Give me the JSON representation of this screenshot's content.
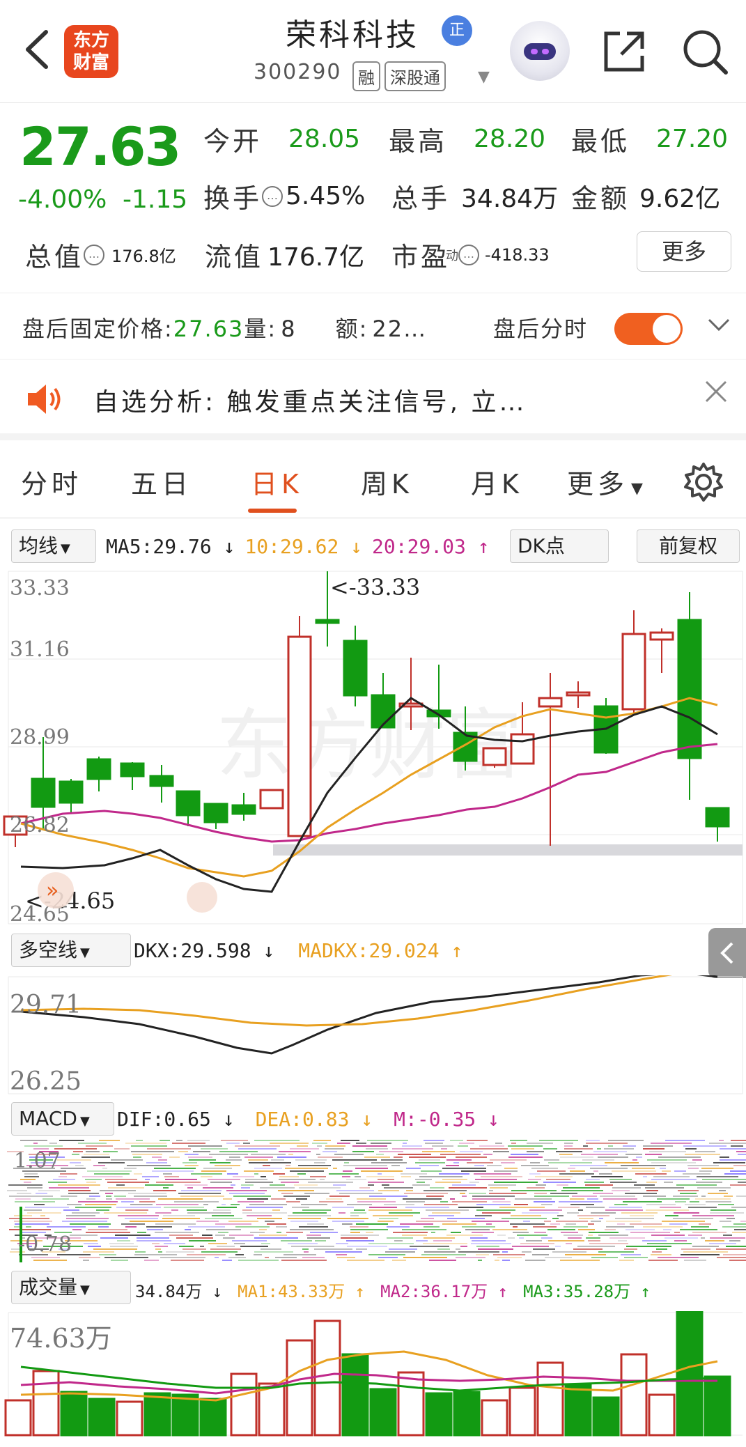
{
  "header": {
    "back_icon": "back-arrow-icon",
    "logo_line1": "东方",
    "logo_line2": "财富",
    "stock_name": "荣科科技",
    "badge": "正",
    "stock_code": "300290",
    "tags": [
      "融",
      "深股通"
    ]
  },
  "quote": {
    "price": "27.63",
    "change_pct": "-4.00%",
    "change_val": "-1.15",
    "open_label": "今开",
    "open": "28.05",
    "high_label": "最高",
    "high": "28.20",
    "low_label": "最低",
    "low": "27.20",
    "turnover_label": "换手",
    "turnover": "5.45%",
    "volume_label": "总手",
    "volume": "34.84万",
    "amount_label": "金额",
    "amount": "9.62亿",
    "mktcap_label": "总值",
    "mktcap": "176.8亿",
    "float_label": "流值",
    "float": "176.7亿",
    "pe_label": "市盈",
    "pe_sup": "动",
    "pe": "-418.33",
    "more_button": "更多"
  },
  "afterhours": {
    "price_label": "盘后固定价格:",
    "price": "27.63",
    "vol_label": "量:",
    "vol": "8",
    "amt_label": "额:",
    "amt": "22…",
    "toggle_label": "盘后分时",
    "toggle_on": true
  },
  "notice": {
    "text": "自选分析: 触发重点关注信号, 立…"
  },
  "tabs": [
    "分时",
    "五日",
    "日K",
    "周K",
    "月K",
    "更多"
  ],
  "active_tab": "日K",
  "kline": {
    "indicator_select": "均线",
    "ma5": "MA5:29.76 ↓",
    "ma10": "10:29.62 ↓",
    "ma20": "20:29.03 ↑",
    "dk_button": "DK点",
    "adjust_button": "前复权",
    "axis_top": "33.33",
    "axis_2": "31.16",
    "axis_3": "28.99",
    "axis_4": "26.82",
    "axis_bottom": "24.65",
    "high_marker": "<-33.33",
    "low_marker": "<-24.65",
    "watermark": "东方财富"
  },
  "dkx": {
    "indicator_select": "多空线",
    "dkx": "DKX:29.598 ↓",
    "madkx": "MADKX:29.024 ↑",
    "axis_top": "29.71",
    "axis_bottom": "26.25"
  },
  "macd": {
    "indicator_select": "MACD",
    "dif": "DIF:0.65 ↓",
    "dea": "DEA:0.83 ↓",
    "m": "M:-0.35 ↓",
    "axis_top": "1.07",
    "axis_bottom": "-0.78"
  },
  "volume": {
    "indicator_select": "成交量",
    "vol": "34.84万 ↓",
    "ma1": "MA1:43.33万 ↑",
    "ma2": "MA2:36.17万 ↑",
    "ma3": "MA3:35.28万 ↑",
    "axis_top": "74.63万"
  },
  "colors": {
    "up": "#c0302a",
    "down": "#129a12",
    "ma5": "#222222",
    "ma10": "#e8a020",
    "ma20": "#c0288a",
    "accent": "#e0501e"
  }
}
